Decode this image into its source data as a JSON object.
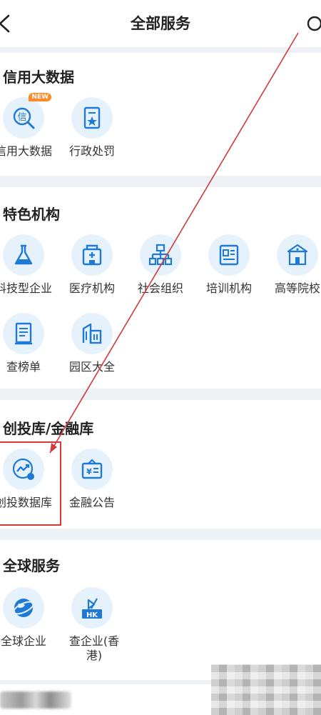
{
  "header": {
    "title": "全部服务",
    "back_icon": "chevron-left-icon",
    "search_icon": "search-icon"
  },
  "colors": {
    "accent_blue": "#1f7ad6",
    "icon_bg": "#e6f2fb",
    "annotation_red": "#d03a3a",
    "badge_orange": "#ff8a2a"
  },
  "sections": [
    {
      "title": "信用大数据",
      "items": [
        {
          "label": "信用大数据",
          "icon": "credit-magnifier-icon",
          "badge": "NEW"
        },
        {
          "label": "行政处罚",
          "icon": "document-star-icon"
        }
      ]
    },
    {
      "title": "特色机构",
      "items": [
        {
          "label": "科技型企业",
          "icon": "flask-icon"
        },
        {
          "label": "医疗机构",
          "icon": "hospital-icon"
        },
        {
          "label": "社会组织",
          "icon": "org-chart-icon"
        },
        {
          "label": "培训机构",
          "icon": "id-card-icon"
        },
        {
          "label": "高等院校",
          "icon": "school-icon"
        },
        {
          "label": "查榜单",
          "icon": "list-book-icon"
        },
        {
          "label": "园区大全",
          "icon": "buildings-icon"
        }
      ]
    },
    {
      "title": "创投库/金融库",
      "items": [
        {
          "label": "创投数据库",
          "icon": "trend-chart-icon"
        },
        {
          "label": "金融公告",
          "icon": "finance-notice-icon"
        }
      ]
    },
    {
      "title": "全球服务",
      "items": [
        {
          "label": "全球企业",
          "icon": "globe-icon"
        },
        {
          "label": "查企业(香港)",
          "icon": "hk-building-icon"
        }
      ]
    }
  ]
}
